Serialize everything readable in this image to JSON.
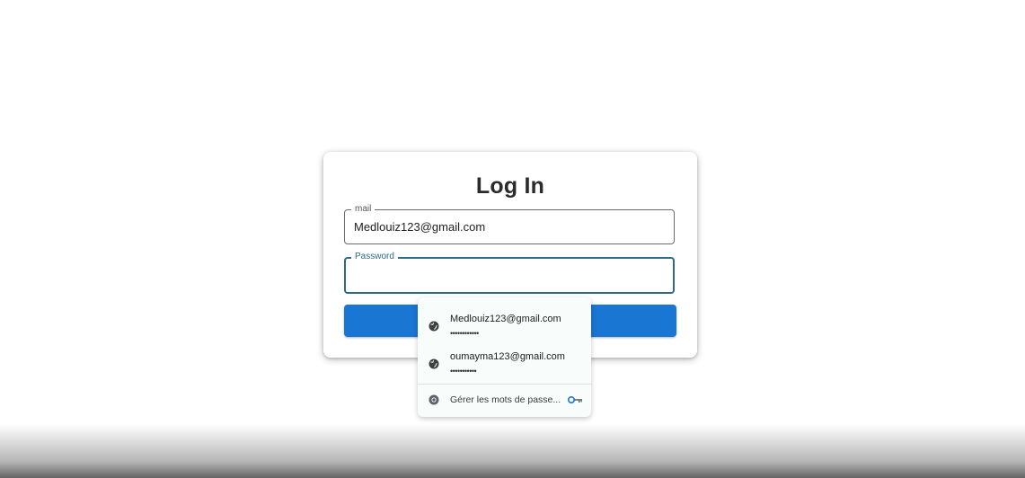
{
  "login": {
    "title": "Log In",
    "email_label": "mail",
    "email_value": "Medlouiz123@gmail.com",
    "password_label": "Password",
    "password_value": ""
  },
  "autofill": {
    "credentials": [
      {
        "email": "Medlouiz123@gmail.com",
        "masked": "••••••••••••"
      },
      {
        "email": "oumayma123@gmail.com",
        "masked": "•••••••••••"
      }
    ],
    "manage_label": "Gérer les mots de passe...",
    "icons": {
      "credential": "globe-icon",
      "manage": "chrome-icon",
      "key": "key-icon"
    }
  },
  "colors": {
    "primary": "#1976d2",
    "focus": "#2e6a88"
  }
}
